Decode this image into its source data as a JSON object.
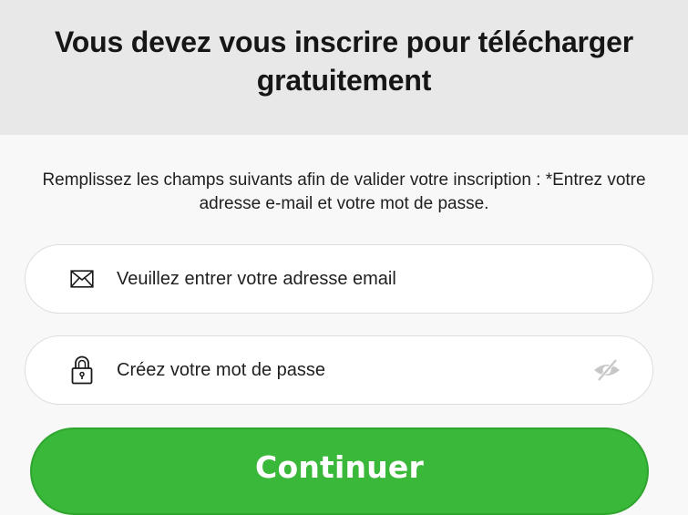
{
  "header": {
    "title": "Vous devez vous inscrire pour télécharger gratuitement"
  },
  "instructions": {
    "text": "Remplissez les champs suivants afin de valider votre inscription : *Entrez votre adresse e-mail et votre mot de passe."
  },
  "email_field": {
    "placeholder": "Veuillez entrer votre adresse email",
    "icon": "envelope-icon"
  },
  "password_field": {
    "placeholder": "Créez votre mot de passe",
    "icon": "lock-icon",
    "toggle_icon": "eye-slash-icon"
  },
  "continue_button": {
    "label": "Continuer"
  },
  "colors": {
    "header_bg": "#e8e8e8",
    "page_bg": "#f8f8f8",
    "button_green": "#3ab83a",
    "field_bg": "#ffffff"
  }
}
